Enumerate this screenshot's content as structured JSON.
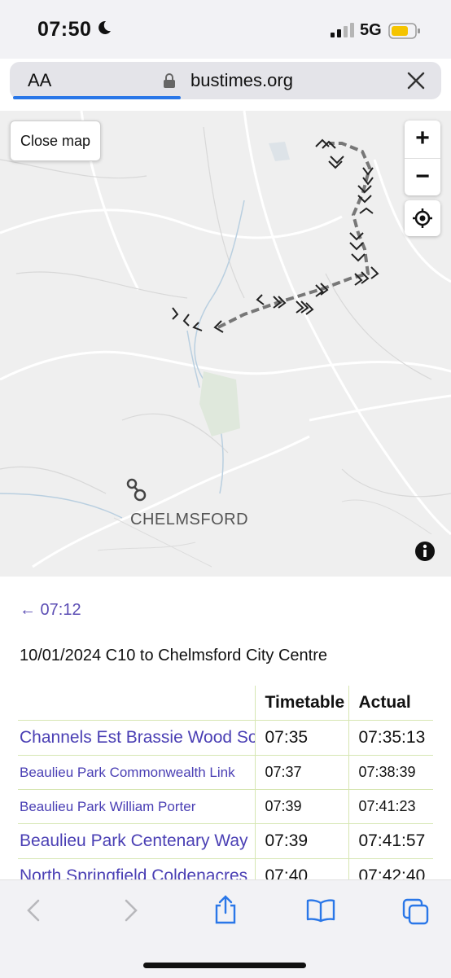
{
  "status_bar": {
    "time": "07:50",
    "network": "5G"
  },
  "url_bar": {
    "text_size_label": "AA",
    "domain": "bustimes.org"
  },
  "map": {
    "close_label": "Close map",
    "zoom_in_label": "+",
    "zoom_out_label": "−",
    "place_label": "CHELMSFORD"
  },
  "journey": {
    "back_link": "← 07:12",
    "title": "10/01/2024 C10 to Chelmsford City Centre",
    "columns": [
      "",
      "Timetable",
      "Actual"
    ],
    "rows": [
      {
        "stop": "Channels Est Brassie Wood South",
        "timetable": "07:35",
        "actual": "07:35:13"
      },
      {
        "stop": "Beaulieu Park Commonwealth Link",
        "timetable": "07:37",
        "actual": "07:38:39"
      },
      {
        "stop": "Beaulieu Park William Porter",
        "timetable": "07:39",
        "actual": "07:41:23"
      },
      {
        "stop": "Beaulieu Park Centenary Way",
        "timetable": "07:39",
        "actual": "07:41:57"
      },
      {
        "stop": "North Springfield Coldenacres",
        "timetable": "07:40",
        "actual": "07:42:40"
      }
    ]
  },
  "colors": {
    "link": "#4a3fb4",
    "accent": "#2a77e8",
    "row_border": "#d6e6b2"
  }
}
